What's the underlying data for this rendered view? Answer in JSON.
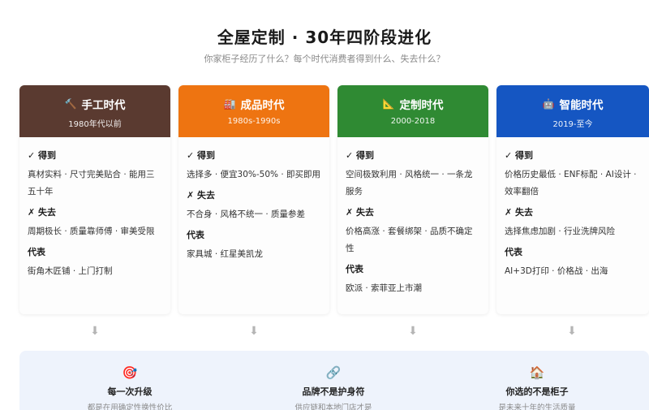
{
  "header": {
    "title": "全屋定制 · 30年四阶段进化",
    "subtitle": "你家柜子经历了什么？每个时代消费者得到什么、失去什么？"
  },
  "labels": {
    "gain": "✓ 得到",
    "loss": "✗ 失去",
    "rep": "代表"
  },
  "stages": [
    {
      "icon": "hammer-icon",
      "icon_glyph": "🔨",
      "name": "手工时代",
      "period": "1980年代以前",
      "color": "#5a3a30",
      "gain": "真材实料 · 尺寸完美贴合 · 能用三五十年",
      "loss": "周期极长 · 质量靠师傅 · 审美受限",
      "rep": "街角木匠铺 · 上门打制"
    },
    {
      "icon": "factory-icon",
      "icon_glyph": "🏭",
      "name": "成品时代",
      "period": "1980s-1990s",
      "color": "#ee7411",
      "gain": "选择多 · 便宜30%-50% · 即买即用",
      "loss": "不合身 · 风格不统一 · 质量参差",
      "rep": "家具城 · 红星美凯龙"
    },
    {
      "icon": "ruler-icon",
      "icon_glyph": "📐",
      "name": "定制时代",
      "period": "2000-2018",
      "color": "#2f8a33",
      "gain": "空间极致利用 · 风格统一 · 一条龙服务",
      "loss": "价格高涨 · 套餐绑架 · 品质不确定性",
      "rep": "欧派 · 索菲亚上市潮"
    },
    {
      "icon": "robot-icon",
      "icon_glyph": "🤖",
      "name": "智能时代",
      "period": "2019-至今",
      "color": "#1556c2",
      "gain": "价格历史最低 · ENF标配 · AI设计 · 效率翻倍",
      "loss": "选择焦虑加剧 · 行业洗牌风险",
      "rep": "AI+3D打印 · 价格战 · 出海"
    }
  ],
  "arrow_glyph": "⬇",
  "footer": {
    "items": [
      {
        "icon": "target-icon",
        "icon_glyph": "🎯",
        "title": "每一次升级",
        "desc": "都是在用确定性换性价比"
      },
      {
        "icon": "link-icon",
        "icon_glyph": "🔗",
        "title": "品牌不是护身符",
        "desc": "供应链和本地门店才是"
      },
      {
        "icon": "house-icon",
        "icon_glyph": "🏠",
        "title": "你选的不是柜子",
        "desc": "是未来十年的生活质量"
      }
    ]
  }
}
